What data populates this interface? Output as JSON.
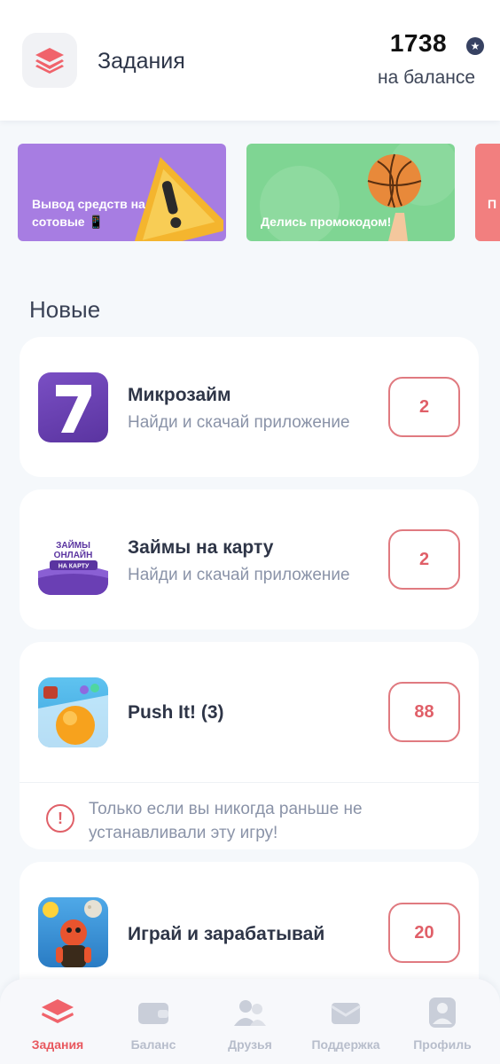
{
  "header": {
    "title": "Задания",
    "balance_value": "1738",
    "balance_label": "на балансе",
    "logo_icon": "layers-icon",
    "currency_icon": "star-icon"
  },
  "banners": [
    {
      "text": "Вывод средств на сотовые 📱",
      "color": "#a77de2",
      "art": "warning-sign"
    },
    {
      "text": "Делись промокодом!",
      "color": "#7fd593",
      "art": "basketball"
    },
    {
      "text": "П Т",
      "color": "#f27f7f"
    }
  ],
  "section": {
    "title": "Новые"
  },
  "tasks": [
    {
      "title": "Микрозайм",
      "subtitle": "Найди и скачай приложение",
      "reward": "2",
      "icon": "seven-app-icon"
    },
    {
      "title": "Займы на карту",
      "subtitle": "Найди и скачай приложение",
      "reward": "2",
      "icon": "loans-app-icon",
      "icon_text": "ЗАЙМЫ ОНЛАЙН НА КАРТУ"
    },
    {
      "title": "Push It! (3)",
      "subtitle": "",
      "reward": "88",
      "icon": "push-it-game-icon",
      "warning": "Только если вы никогда раньше не устанавливали эту игру!"
    },
    {
      "title": "Играй и зарабатывай",
      "subtitle": "",
      "reward": "20",
      "icon": "play-earn-game-icon"
    }
  ],
  "nav": {
    "items": [
      {
        "label": "Задания",
        "icon": "tasks-icon",
        "active": true
      },
      {
        "label": "Баланс",
        "icon": "wallet-icon",
        "active": false
      },
      {
        "label": "Друзья",
        "icon": "friends-icon",
        "active": false
      },
      {
        "label": "Поддержка",
        "icon": "support-icon",
        "active": false
      },
      {
        "label": "Профиль",
        "icon": "profile-icon",
        "active": false
      }
    ]
  },
  "colors": {
    "accent": "#e8585f",
    "background": "#f5f8fb",
    "text_primary": "#2e3547",
    "text_secondary": "#8a93a8"
  }
}
